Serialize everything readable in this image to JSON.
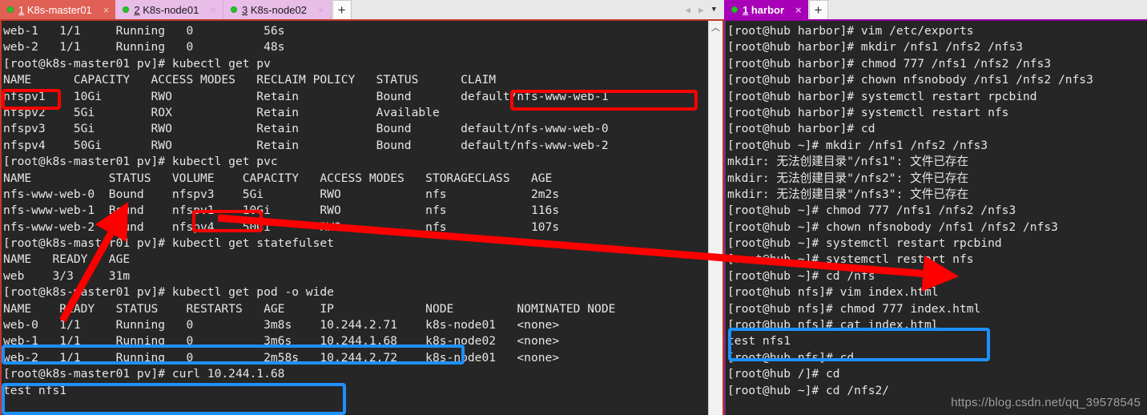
{
  "window_left": {
    "tabs": [
      {
        "num": "1",
        "label": "K8s-master01",
        "state": "active",
        "dot": "green-status-dot",
        "close": "×"
      },
      {
        "num": "2",
        "label": "K8s-node01",
        "state": "inactive",
        "dot": "green-status-dot",
        "close": "×"
      },
      {
        "num": "3",
        "label": "K8s-node02",
        "state": "inactive",
        "dot": "green-status-dot",
        "close": "×"
      }
    ],
    "new_tab_label": "+",
    "controls": {
      "prev": "◀",
      "next": "▶",
      "menu": "▼"
    },
    "scrollbar": {
      "up_arrow": "︿"
    },
    "terminal_lines": [
      "web-1   1/1     Running   0          56s",
      "web-2   1/1     Running   0          48s",
      "[root@k8s-master01 pv]# kubectl get pv",
      "NAME      CAPACITY   ACCESS MODES   RECLAIM POLICY   STATUS      CLAIM",
      "nfspv1    10Gi       RWO            Retain           Bound       default/nfs-www-web-1",
      "nfspv2    5Gi        ROX            Retain           Available",
      "nfspv3    5Gi        RWO            Retain           Bound       default/nfs-www-web-0",
      "nfspv4    50Gi       RWO            Retain           Bound       default/nfs-www-web-2",
      "[root@k8s-master01 pv]# kubectl get pvc",
      "NAME           STATUS   VOLUME    CAPACITY   ACCESS MODES   STORAGECLASS   AGE",
      "nfs-www-web-0  Bound    nfspv3    5Gi        RWO            nfs            2m2s",
      "nfs-www-web-1  Bound    nfspv1    10Gi       RWO            nfs            116s",
      "nfs-www-web-2  Bound    nfspv4    50Gi       RWO            nfs            107s",
      "[root@k8s-master01 pv]# kubectl get statefulset",
      "NAME   READY   AGE",
      "web    3/3     31m",
      "[root@k8s-master01 pv]# kubectl get pod -o wide",
      "NAME    READY   STATUS    RESTARTS   AGE     IP             NODE         NOMINATED NODE",
      "web-0   1/1     Running   0          3m8s    10.244.2.71    k8s-node01   <none>",
      "web-1   1/1     Running   0          3m6s    10.244.1.68    k8s-node02   <none>",
      "web-2   1/1     Running   0          2m58s   10.244.2.72    k8s-node01   <none>",
      "[root@k8s-master01 pv]# curl 10.244.1.68",
      "test nfs1"
    ]
  },
  "window_right": {
    "tabs": [
      {
        "num": "1",
        "label": "harbor",
        "state": "active",
        "dot": "green-status-dot",
        "close": "×"
      }
    ],
    "new_tab_label": "+",
    "terminal_lines": [
      "[root@hub harbor]# vim /etc/exports",
      "[root@hub harbor]# mkdir /nfs1 /nfs2 /nfs3",
      "[root@hub harbor]# chmod 777 /nfs1 /nfs2 /nfs3",
      "[root@hub harbor]# chown nfsnobody /nfs1 /nfs2 /nfs3",
      "[root@hub harbor]# systemctl restart rpcbind",
      "[root@hub harbor]# systemctl restart nfs",
      "[root@hub harbor]# cd",
      "[root@hub ~]# mkdir /nfs1 /nfs2 /nfs3",
      "mkdir: 无法创建目录\"/nfs1\": 文件已存在",
      "mkdir: 无法创建目录\"/nfs2\": 文件已存在",
      "mkdir: 无法创建目录\"/nfs3\": 文件已存在",
      "[root@hub ~]# chmod 777 /nfs1 /nfs2 /nfs3",
      "[root@hub ~]# chown nfsnobody /nfs1 /nfs2 /nfs3",
      "[root@hub ~]# systemctl restart rpcbind",
      "[root@hub ~]# systemctl restart nfs",
      "[root@hub ~]# cd /nfs",
      "[root@hub nfs]# vim index.html",
      "[root@hub nfs]# chmod 777 index.html",
      "[root@hub nfs]# cat index.html",
      "test nfs1",
      "[root@hub nfs]# cd ..",
      "[root@hub /]# cd",
      "[root@hub ~]# cd /nfs2/"
    ]
  },
  "annotations": {
    "highlight_color_red": "#ff0000",
    "highlight_color_blue": "#1e90ff",
    "boxes": [
      {
        "name": "pv-name-nfspv1",
        "color": "red"
      },
      {
        "name": "pv-claim-nfs-www-web-1",
        "color": "red"
      },
      {
        "name": "pvc-volume-nfspv1",
        "color": "red"
      },
      {
        "name": "pod-web-1-row",
        "color": "blue"
      },
      {
        "name": "curl-command-output",
        "color": "blue"
      },
      {
        "name": "cat-index-html-output",
        "color": "blue"
      }
    ],
    "arrows": [
      {
        "name": "arrow-pvc-to-pod",
        "color": "red"
      },
      {
        "name": "arrow-nfspv1-to-nfs-mount",
        "color": "red"
      }
    ]
  },
  "watermark": {
    "text": "https://blog.csdn.net/qq_39578545"
  }
}
